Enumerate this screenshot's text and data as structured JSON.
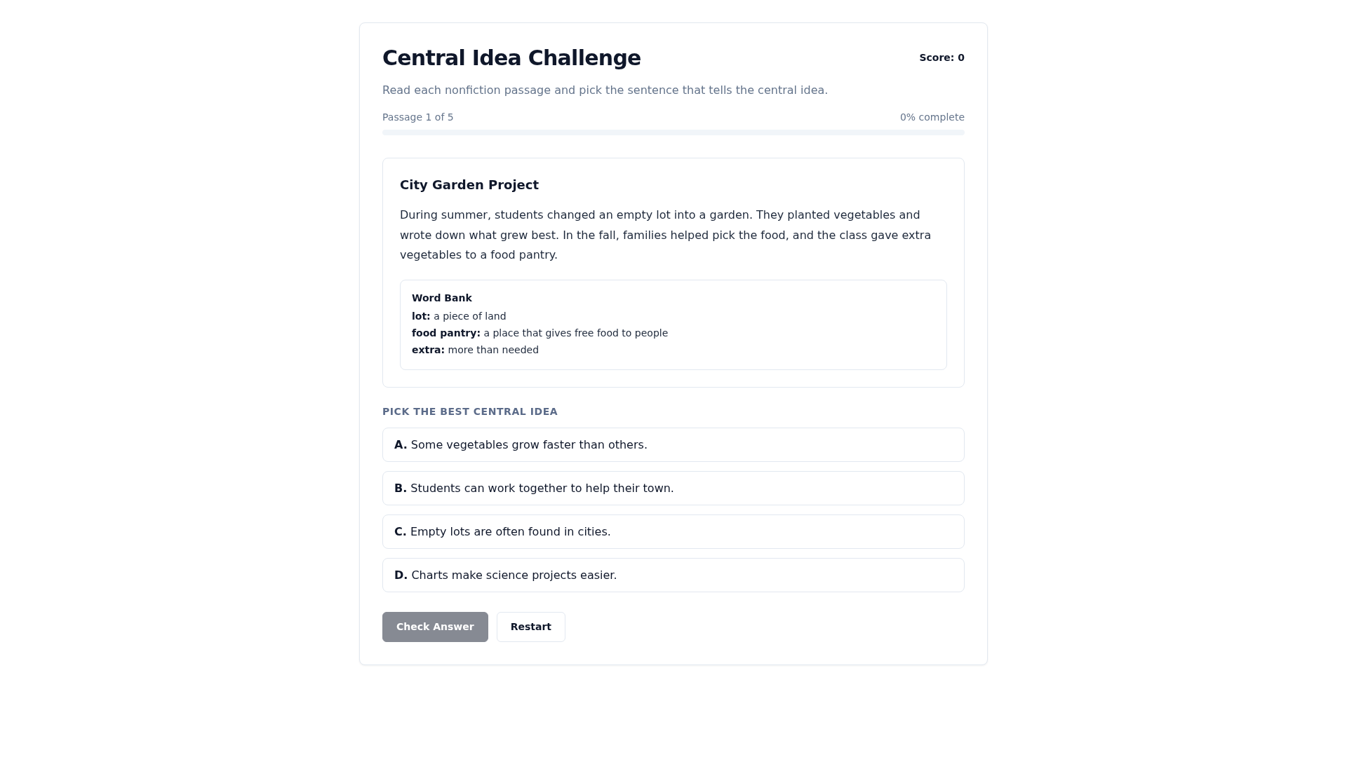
{
  "header": {
    "title": "Central Idea Challenge",
    "score": "Score: 0",
    "subtitle": "Read each nonfiction passage and pick the sentence that tells the central idea."
  },
  "progress": {
    "label": "Passage 1 of 5",
    "reading": "0% complete"
  },
  "passage": {
    "title": "City Garden Project",
    "text": "During summer, students changed an empty lot into a garden. They planted vegetables and wrote down what grew best. In the fall, families helped pick the food, and the class gave extra vegetables to a food pantry.",
    "word_bank": {
      "title": "Word Bank",
      "entries": [
        "**lot:** a piece of land",
        "**food pantry:** a place that gives free food to people",
        "**extra:** more than needed"
      ]
    }
  },
  "question": {
    "prompt": "PICK THE BEST CENTRAL IDEA",
    "options": [
      {
        "text": "**A.** Some vegetables grow faster than others.",
        "selected": false
      },
      {
        "text": "**B.** Students can work together to help their town.",
        "selected": false
      },
      {
        "text": "**C.** Empty lots are often found in cities.",
        "selected": false
      },
      {
        "text": "**D.** Charts make science projects easier.",
        "selected": false
      }
    ]
  },
  "buttons": [
    {
      "label": "Check Answer",
      "kind": "primary",
      "disabled": true
    },
    {
      "label": "Restart",
      "kind": "secondary",
      "disabled": false
    }
  ]
}
